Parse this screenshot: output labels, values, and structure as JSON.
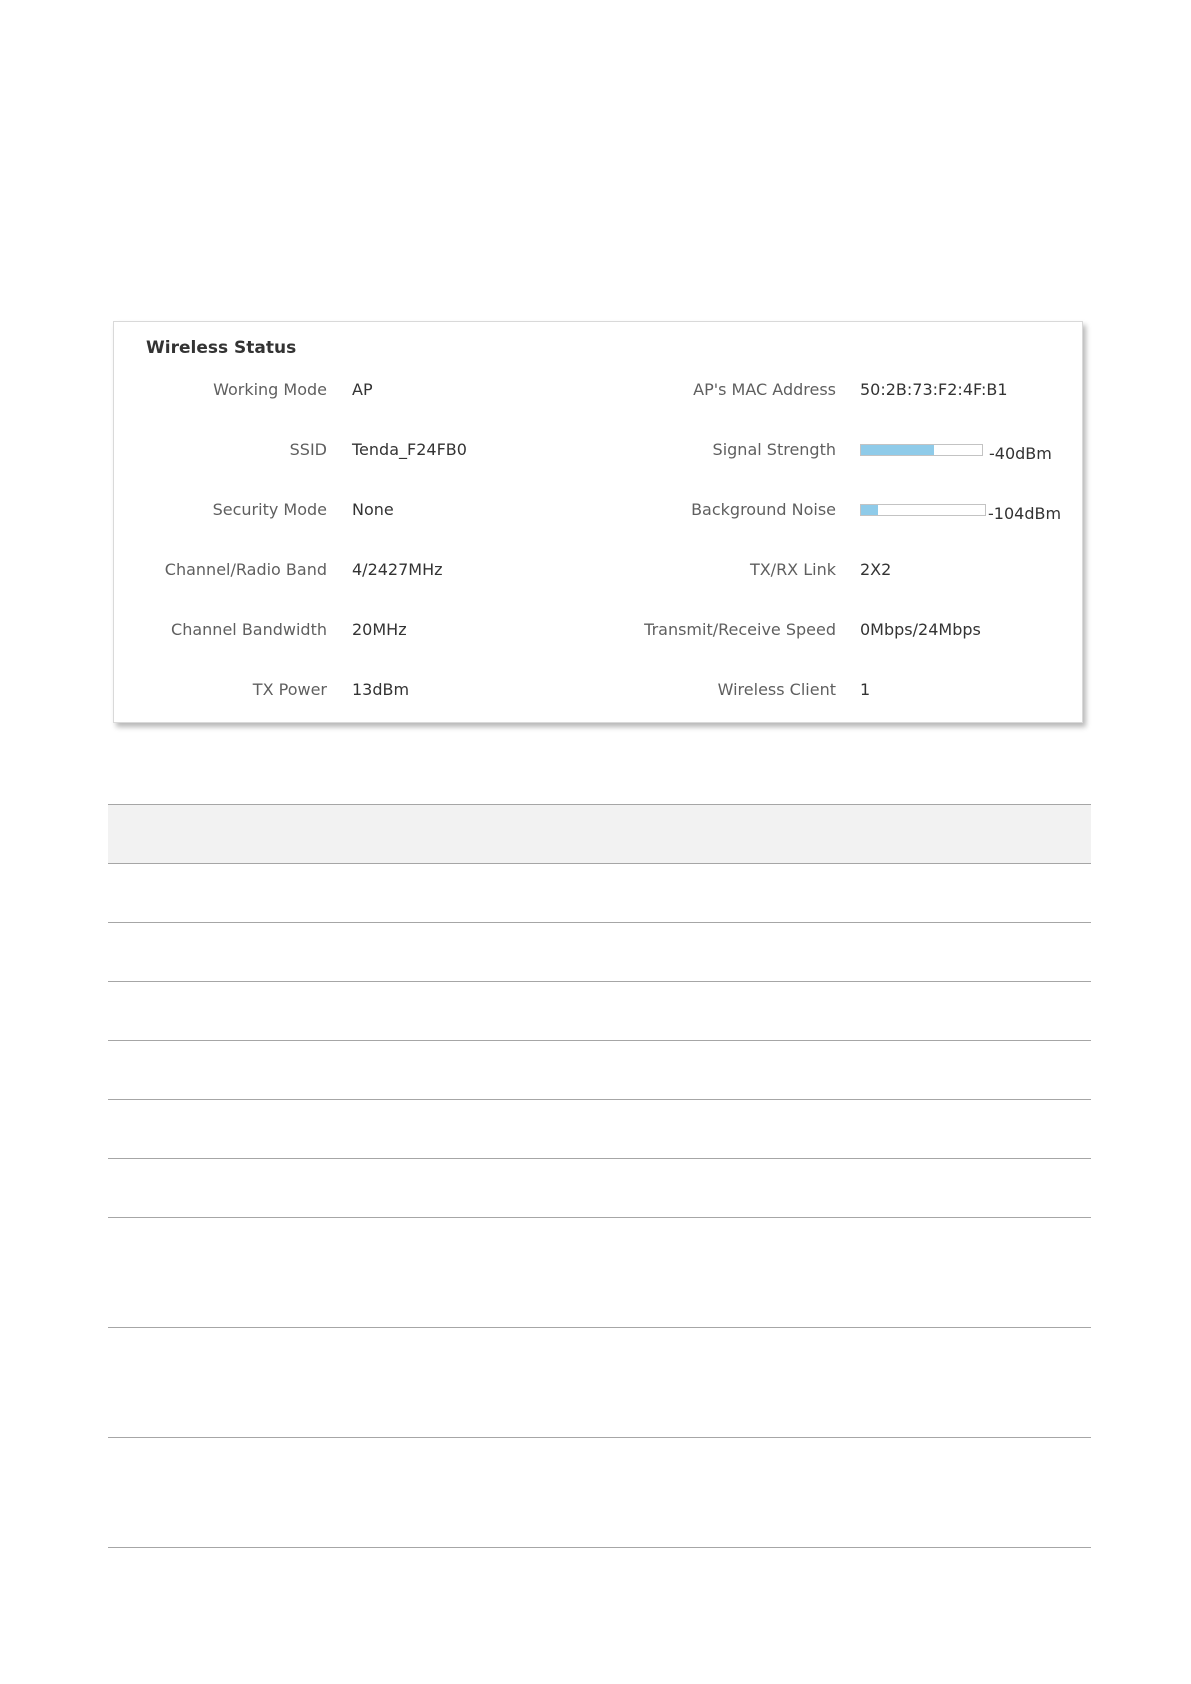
{
  "panel": {
    "title": "Wireless Status",
    "left_rows": [
      {
        "label": "Working Mode",
        "value": "AP"
      },
      {
        "label": "SSID",
        "value": "Tenda_F24FB0"
      },
      {
        "label": "Security Mode",
        "value": "None"
      },
      {
        "label": "Channel/Radio Band",
        "value": "4/2427MHz"
      },
      {
        "label": "Channel Bandwidth",
        "value": "20MHz"
      },
      {
        "label": "TX Power",
        "value": "13dBm"
      }
    ],
    "right_rows": [
      {
        "label": "AP's MAC Address",
        "value": "50:2B:73:F2:4F:B1"
      },
      {
        "label": "Signal Strength",
        "value": "-40dBm",
        "level_percent": 60
      },
      {
        "label": "Background Noise",
        "value": "-104dBm",
        "level_percent": 14
      },
      {
        "label": "TX/RX Link",
        "value": "2X2"
      },
      {
        "label": "Transmit/Receive Speed",
        "value": "0Mbps/24Mbps"
      },
      {
        "label": "Wireless Client",
        "value": "1"
      }
    ],
    "meter_color": "#8fcbe9"
  }
}
